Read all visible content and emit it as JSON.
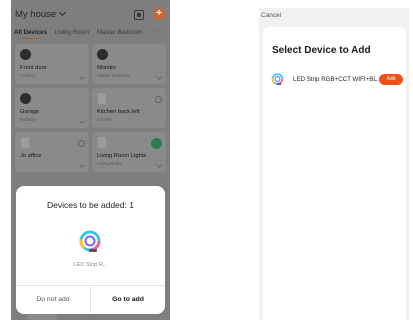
{
  "left_screen": {
    "home_title": "My house",
    "tabs": [
      "All Devices",
      "Living Room",
      "Master Bedroom"
    ],
    "more_tabs": "···",
    "add_symbol": "+",
    "devices": [
      {
        "name": "Front door",
        "room": "Hallway"
      },
      {
        "name": "Monitor",
        "room": "Master Bedroom"
      },
      {
        "name": "Garage",
        "room": "Hallway"
      },
      {
        "name": "Kitchen back left",
        "room": "Kitchen"
      },
      {
        "name": "Jo office",
        "room": ""
      },
      {
        "name": "Living Room Lights",
        "room": "Living Room"
      }
    ],
    "dialog": {
      "title": "Devices to be added: 1",
      "device_name": "LED Strip R...",
      "decline_label": "Do not add",
      "accept_label": "Go to add"
    }
  },
  "right_screen": {
    "cancel_label": "Cancel",
    "title": "Select Device to Add",
    "device_name": "LED Strip RGB+CCT WIFI+BL...",
    "add_label": "Add"
  },
  "colors": {
    "accent": "#f04f16",
    "power_on": "#2e7d52"
  }
}
